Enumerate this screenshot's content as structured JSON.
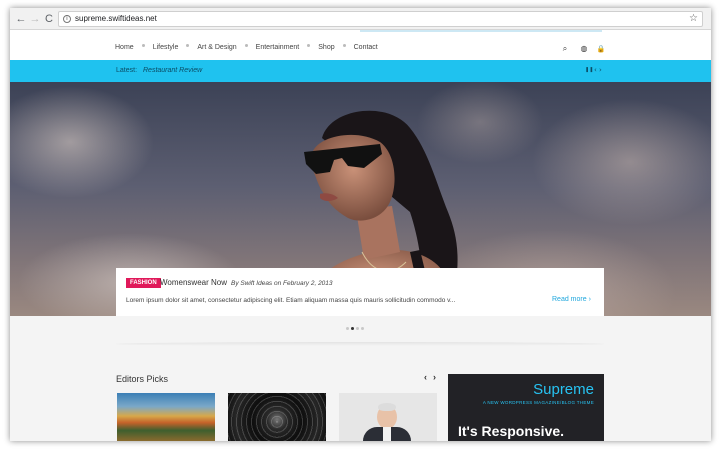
{
  "browser": {
    "back": "←",
    "forward": "→",
    "reload": "C",
    "url": "supreme.swiftideas.net",
    "info_icon": "i",
    "star_icon": "☆"
  },
  "header": {
    "menu": [
      {
        "label": "Home"
      },
      {
        "label": "Lifestyle"
      },
      {
        "label": "Art & Design"
      },
      {
        "label": "Entertainment"
      },
      {
        "label": "Shop"
      },
      {
        "label": "Contact"
      }
    ],
    "icons": {
      "search": "⌕",
      "globe": "◍",
      "lock": "🔒"
    }
  },
  "ticker": {
    "label": "Latest:",
    "headline": "Restaurant Review",
    "pause": "❚❚",
    "prev": "‹",
    "next": "›"
  },
  "hero": {
    "category": "FASHION",
    "title": "Womenswear Now",
    "meta": "By Swift Ideas on February 2, 2013",
    "excerpt": "Lorem ipsum dolor sit amet, consectetur adipiscing elit. Etiam aliquam massa quis mauris sollicitudin commodo v...",
    "read_more": "Read more ›",
    "slide_count": 4,
    "active_slide": 2
  },
  "editors_picks": {
    "title": "Editors Picks",
    "prev": "‹",
    "next": "›"
  },
  "ad": {
    "brand": "Supreme",
    "tagline": "A NEW WORDPRESS MAGAZINE/BLOG THEME",
    "headline": "It's Responsive."
  },
  "colors": {
    "accent": "#1fc2ef",
    "badge": "#e0195a",
    "ad_background": "#222226"
  }
}
